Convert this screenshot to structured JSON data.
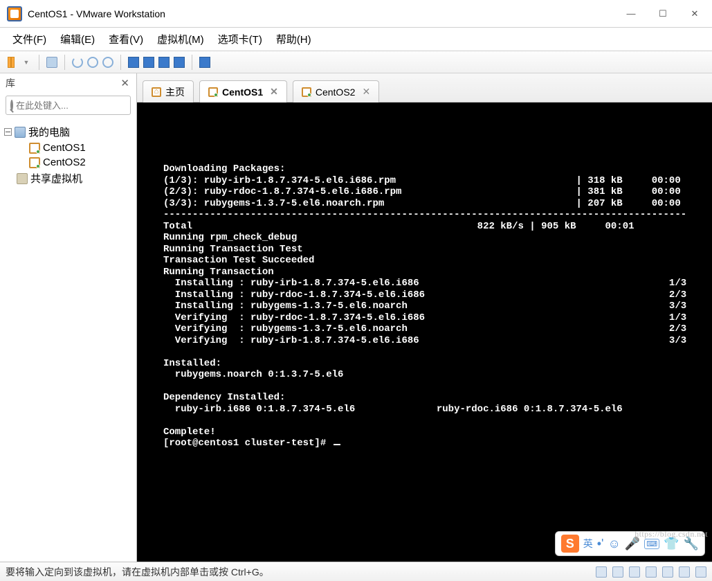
{
  "window": {
    "title": "CentOS1 - VMware Workstation"
  },
  "menu": [
    "文件(F)",
    "编辑(E)",
    "查看(V)",
    "虚拟机(M)",
    "选项卡(T)",
    "帮助(H)"
  ],
  "sidebar": {
    "title": "库",
    "search_placeholder": "在此处键入...",
    "root": "我的电脑",
    "items": [
      "CentOS1",
      "CentOS2"
    ],
    "shared": "共享虚拟机"
  },
  "tabs": [
    {
      "label": "主页",
      "icon": "home",
      "active": false,
      "closable": false
    },
    {
      "label": "CentOS1",
      "icon": "vm",
      "active": true,
      "closable": true
    },
    {
      "label": "CentOS2",
      "icon": "vm",
      "active": false,
      "closable": true
    }
  ],
  "terminal": {
    "lines": [
      "Downloading Packages:",
      "(1/3): ruby-irb-1.8.7.374-5.el6.i686.rpm                               | 318 kB     00:00",
      "(2/3): ruby-rdoc-1.8.7.374-5.el6.i686.rpm                              | 381 kB     00:00",
      "(3/3): rubygems-1.3.7-5.el6.noarch.rpm                                 | 207 kB     00:00",
      "------------------------------------------------------------------------------------------",
      "Total                                                 822 kB/s | 905 kB     00:01",
      "Running rpm_check_debug",
      "Running Transaction Test",
      "Transaction Test Succeeded",
      "Running Transaction",
      "  Installing : ruby-irb-1.8.7.374-5.el6.i686                                           1/3",
      "  Installing : ruby-rdoc-1.8.7.374-5.el6.i686                                          2/3",
      "  Installing : rubygems-1.3.7-5.el6.noarch                                             3/3",
      "  Verifying  : ruby-rdoc-1.8.7.374-5.el6.i686                                          1/3",
      "  Verifying  : rubygems-1.3.7-5.el6.noarch                                             2/3",
      "  Verifying  : ruby-irb-1.8.7.374-5.el6.i686                                           3/3",
      "",
      "Installed:",
      "  rubygems.noarch 0:1.3.7-5.el6",
      "",
      "Dependency Installed:",
      "  ruby-irb.i686 0:1.8.7.374-5.el6              ruby-rdoc.i686 0:1.8.7.374-5.el6",
      "",
      "Complete!",
      "[root@centos1 cluster-test]# "
    ]
  },
  "statusbar": {
    "text": "要将输入定向到该虚拟机，请在虚拟机内部单击或按 Ctrl+G。"
  },
  "ime": {
    "label": "英"
  },
  "watermark": "https://blog.csdn.net"
}
